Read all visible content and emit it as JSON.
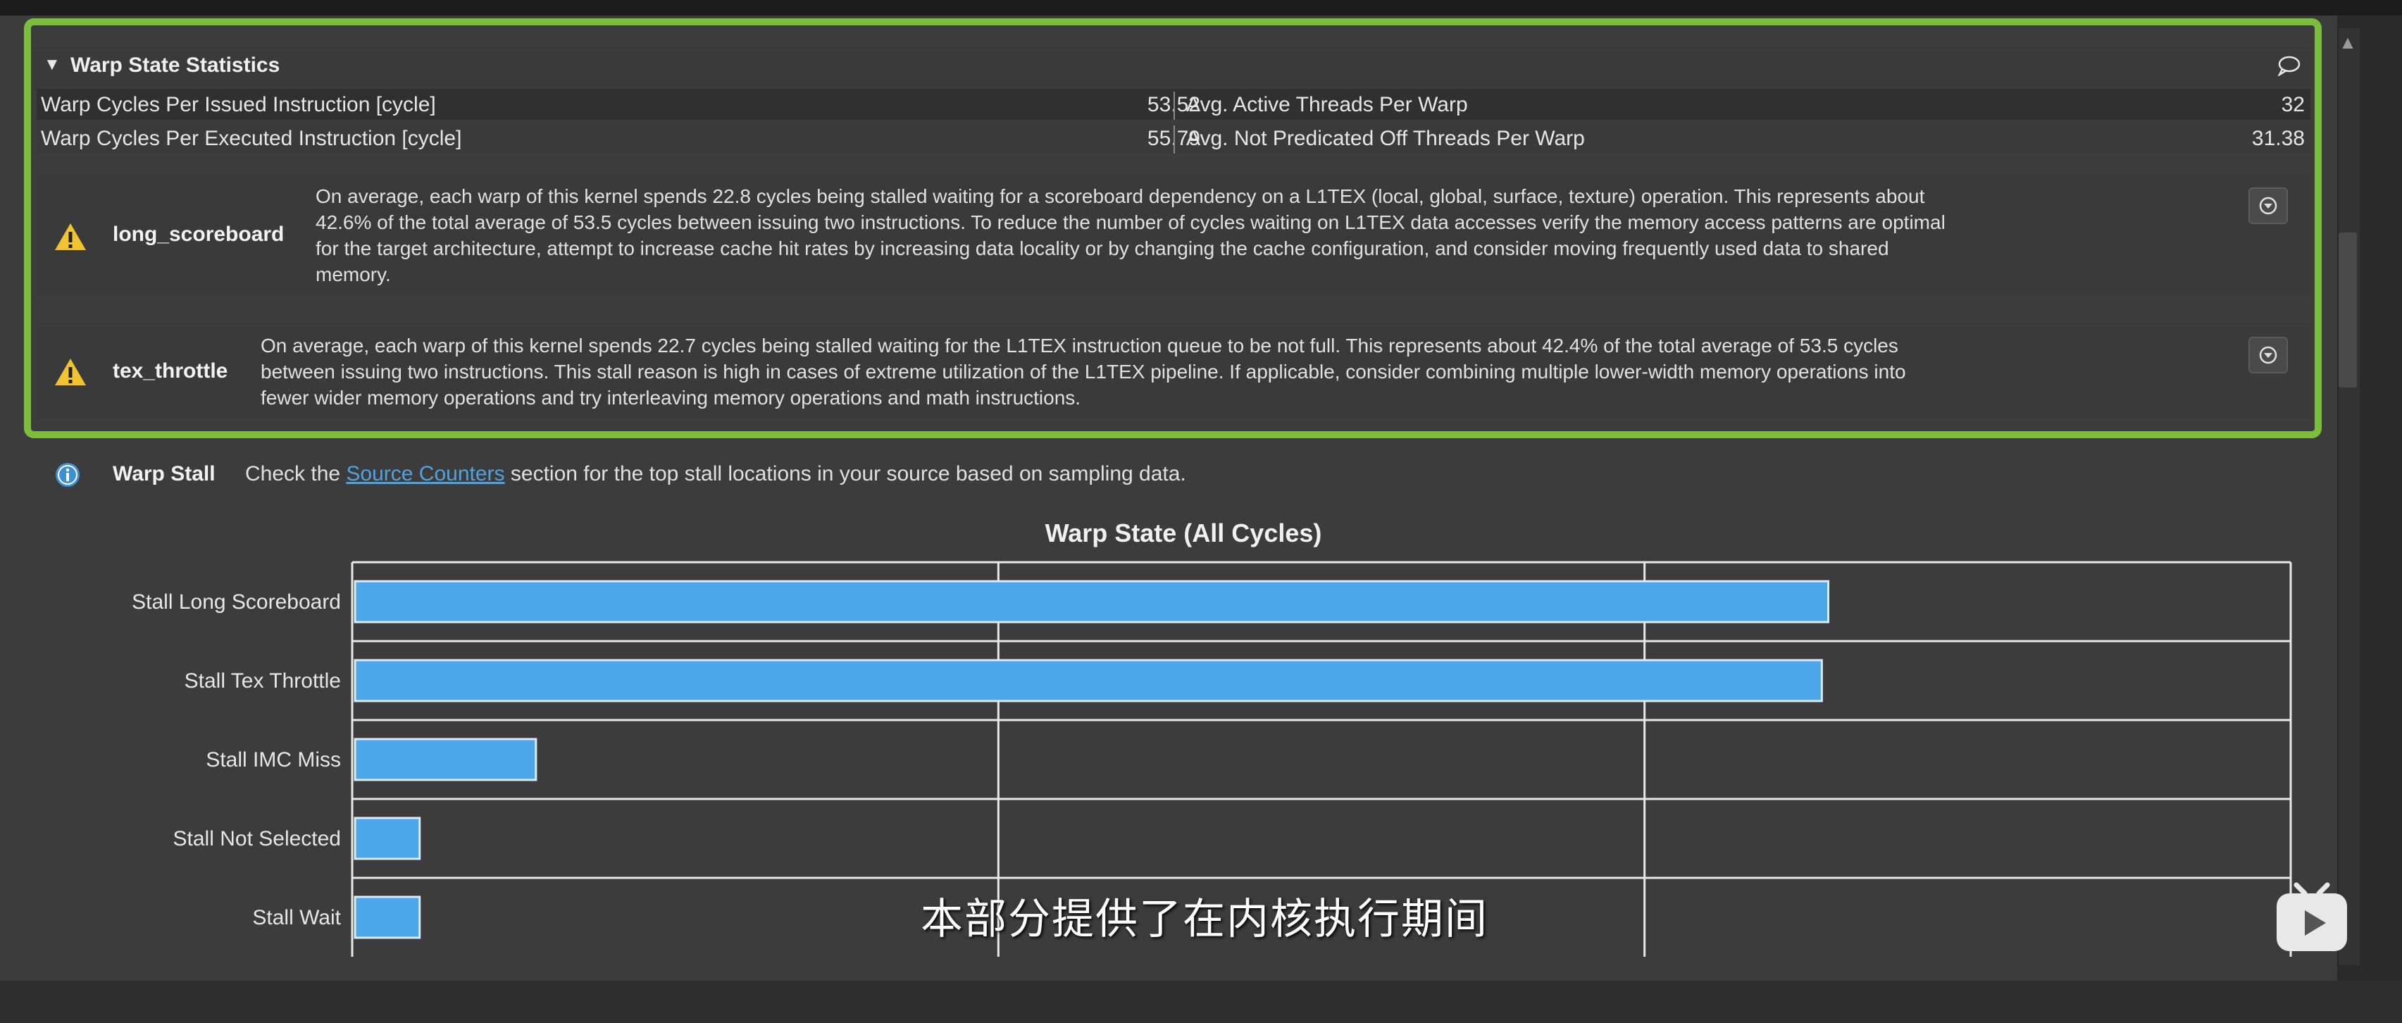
{
  "section": {
    "title": "Warp State Statistics"
  },
  "metrics": [
    {
      "label": "Warp Cycles Per Issued Instruction [cycle]",
      "value": "53.52",
      "label2": "Avg. Active Threads Per Warp",
      "value2": "32"
    },
    {
      "label": "Warp Cycles Per Executed Instruction [cycle]",
      "value": "55.79",
      "label2": "Avg. Not Predicated Off Threads Per Warp",
      "value2": "31.38"
    }
  ],
  "warnings": [
    {
      "name": "long_scoreboard",
      "lines": [
        "On average, each warp of this kernel spends 22.8 cycles being stalled waiting for a scoreboard dependency on a L1TEX (local, global, surface, texture) operation. This represents about",
        "42.6% of the total average of 53.5 cycles between issuing two instructions. To reduce the number of cycles waiting on L1TEX data accesses verify the memory access patterns are optimal",
        "for the target architecture, attempt to increase cache hit rates by increasing data locality or by changing the cache configuration, and consider moving frequently used data to shared",
        "memory."
      ]
    },
    {
      "name": "tex_throttle",
      "lines": [
        "On average, each warp of this kernel spends 22.7 cycles being stalled waiting for the L1TEX instruction queue to be not full. This represents about 42.4% of the total average of 53.5 cycles",
        "between issuing two instructions. This stall reason is high in cases of extreme utilization of the L1TEX pipeline. If applicable, consider combining multiple lower-width memory operations into",
        "fewer wider memory operations and try interleaving memory operations and math instructions."
      ]
    }
  ],
  "info": {
    "name": "Warp Stall",
    "text_before": "Check the ",
    "link": "Source Counters",
    "text_after": " section for the top stall locations in your source based on sampling data."
  },
  "chart_data": {
    "type": "bar",
    "orientation": "horizontal",
    "title": "Warp State (All Cycles)",
    "categories": [
      "Stall Long Scoreboard",
      "Stall Tex Throttle",
      "Stall IMC Miss",
      "Stall Not Selected",
      "Stall Wait"
    ],
    "values": [
      22.8,
      22.7,
      2.8,
      1.0,
      1.0
    ],
    "xlim": [
      0,
      30
    ],
    "grid": true,
    "bar_color": "#4ea6ea"
  },
  "subtitle": "本部分提供了在内核执行期间",
  "colors": {
    "highlight": "#7bbd3d",
    "warning": "#f2c230",
    "info": "#3d8fd6",
    "link": "#4fa3e0"
  }
}
